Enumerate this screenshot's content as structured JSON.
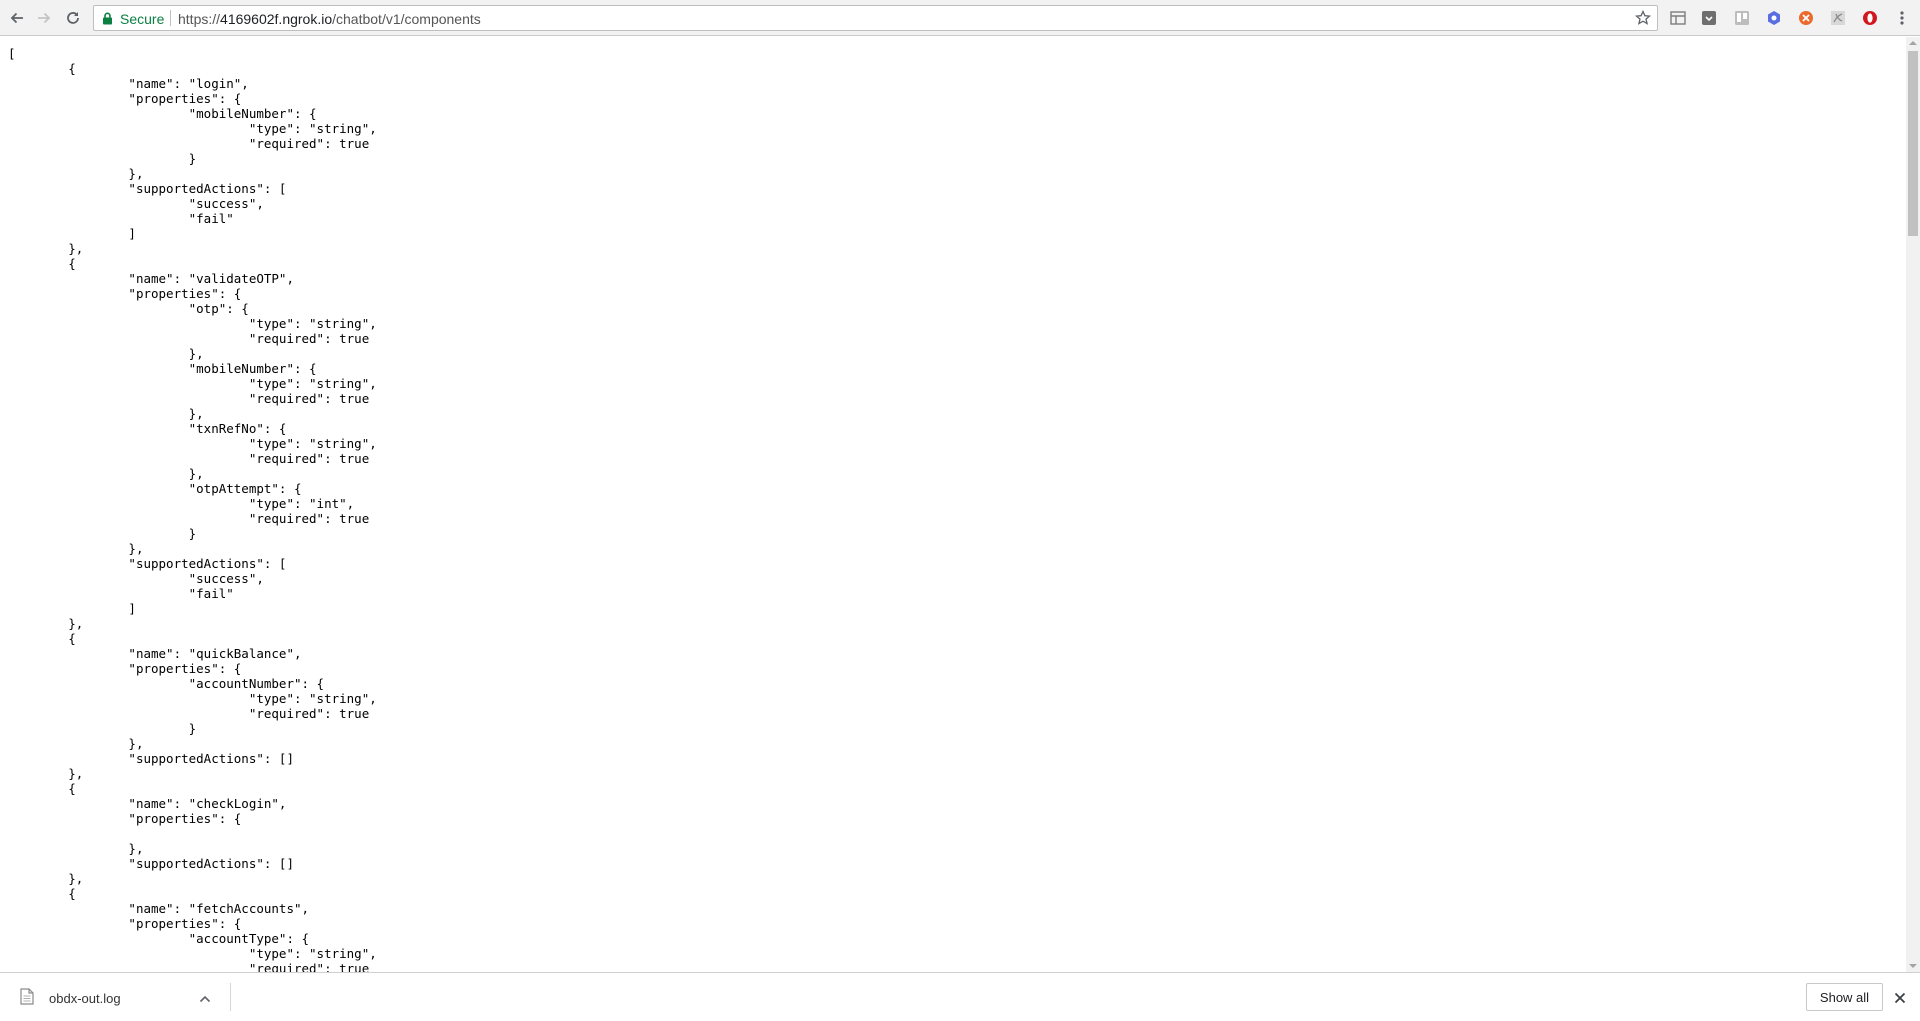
{
  "browser": {
    "security_label": "Secure",
    "url_scheme": "https://",
    "url_host": "4169602f.ngrok.io",
    "url_path": "/chatbot/v1/components",
    "nav_icons": [
      "back-arrow-icon",
      "forward-arrow-icon",
      "reload-icon"
    ],
    "extension_icons": [
      "reading-list-icon",
      "pocket-icon",
      "trello-icon",
      "chrome-extension-icon",
      "close-circle-extension-icon",
      "pdf-extension-icon",
      "opera-extension-icon",
      "more-menu-icon"
    ],
    "colors": {
      "secure": "#0b8043",
      "toolbar": "#f2f2f2"
    }
  },
  "page": {
    "json_lines": [
      "[",
      "\t{",
      "\t\t\"name\": \"login\",",
      "\t\t\"properties\": {",
      "\t\t\t\"mobileNumber\": {",
      "\t\t\t\t\"type\": \"string\",",
      "\t\t\t\t\"required\": true",
      "\t\t\t}",
      "\t\t},",
      "\t\t\"supportedActions\": [",
      "\t\t\t\"success\",",
      "\t\t\t\"fail\"",
      "\t\t]",
      "\t},",
      "\t{",
      "\t\t\"name\": \"validateOTP\",",
      "\t\t\"properties\": {",
      "\t\t\t\"otp\": {",
      "\t\t\t\t\"type\": \"string\",",
      "\t\t\t\t\"required\": true",
      "\t\t\t},",
      "\t\t\t\"mobileNumber\": {",
      "\t\t\t\t\"type\": \"string\",",
      "\t\t\t\t\"required\": true",
      "\t\t\t},",
      "\t\t\t\"txnRefNo\": {",
      "\t\t\t\t\"type\": \"string\",",
      "\t\t\t\t\"required\": true",
      "\t\t\t},",
      "\t\t\t\"otpAttempt\": {",
      "\t\t\t\t\"type\": \"int\",",
      "\t\t\t\t\"required\": true",
      "\t\t\t}",
      "\t\t},",
      "\t\t\"supportedActions\": [",
      "\t\t\t\"success\",",
      "\t\t\t\"fail\"",
      "\t\t]",
      "\t},",
      "\t{",
      "\t\t\"name\": \"quickBalance\",",
      "\t\t\"properties\": {",
      "\t\t\t\"accountNumber\": {",
      "\t\t\t\t\"type\": \"string\",",
      "\t\t\t\t\"required\": true",
      "\t\t\t}",
      "\t\t},",
      "\t\t\"supportedActions\": []",
      "\t},",
      "\t{",
      "\t\t\"name\": \"checkLogin\",",
      "\t\t\"properties\": {",
      "",
      "\t\t},",
      "\t\t\"supportedActions\": []",
      "\t},",
      "\t{",
      "\t\t\"name\": \"fetchAccounts\",",
      "\t\t\"properties\": {",
      "\t\t\t\"accountType\": {",
      "\t\t\t\t\"type\": \"string\",",
      "\t\t\t\t\"required\": true"
    ]
  },
  "download_shelf": {
    "file_name": "obdx-out.log",
    "show_all_label": "Show all"
  }
}
